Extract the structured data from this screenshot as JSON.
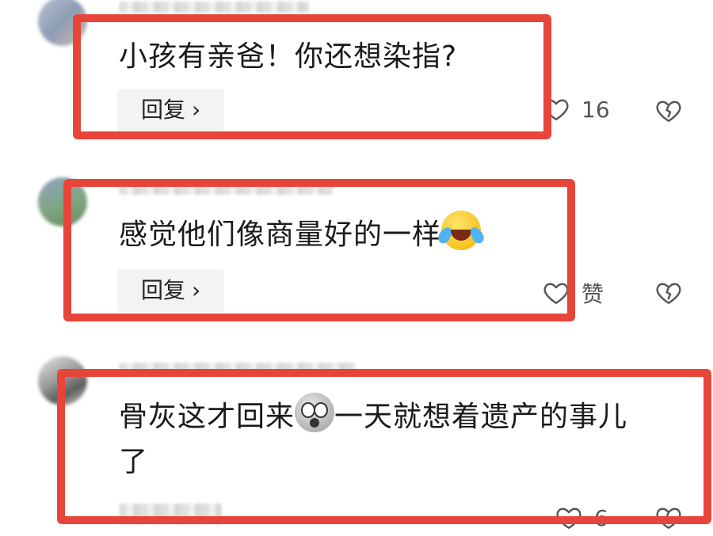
{
  "comments": [
    {
      "text": "小孩有亲爸！你还想染指?",
      "reply_label": "回复",
      "like_count": "16"
    },
    {
      "text": "感觉他们像商量好的一样",
      "reply_label": "回复",
      "like_count": "赞"
    },
    {
      "text_part1": "骨灰这才回来",
      "text_part2": "一天就想着遗产的事儿",
      "text_line2": "了",
      "like_count": "6"
    }
  ],
  "icons": {
    "like": "heart-outline-icon",
    "dislike": "broken-heart-icon",
    "reply_chevron": "chevron-right-icon",
    "emoji_1": "laughing-crying-emoji-icon",
    "emoji_2": "shocked-emoji-icon"
  },
  "colors": {
    "highlight": "#e8453a",
    "reply_bg": "#f3f3f3",
    "text": "#1a1a1a",
    "icon": "#555555"
  }
}
